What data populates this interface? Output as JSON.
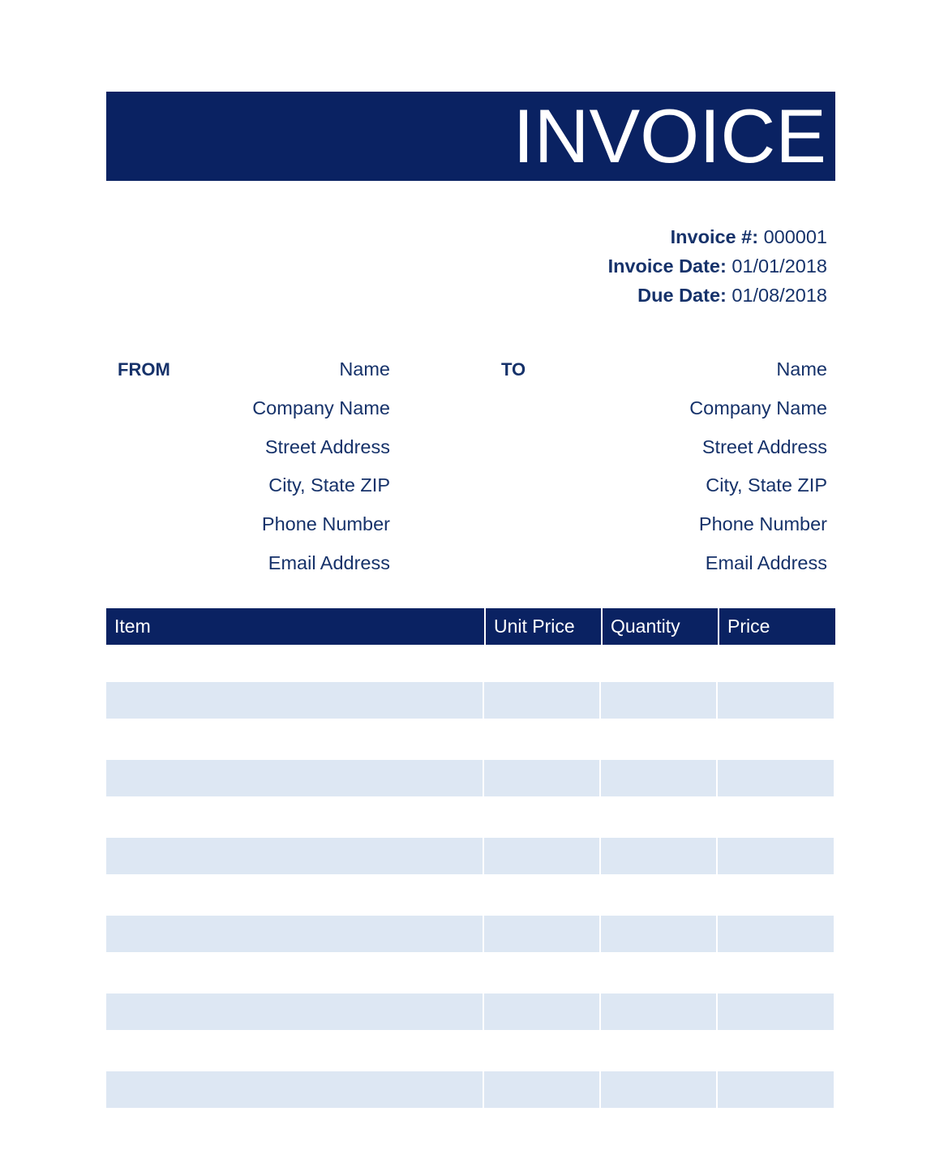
{
  "document": {
    "title": "INVOICE"
  },
  "colors": {
    "navy": "#0a2262",
    "text_navy": "#16326a",
    "row_fill": "#dde7f3",
    "white": "#ffffff"
  },
  "meta": {
    "invoice_number_label": "Invoice #:",
    "invoice_number_value": "000001",
    "invoice_date_label": "Invoice Date:",
    "invoice_date_value": "01/01/2018",
    "due_date_label": "Due Date:",
    "due_date_value": "01/08/2018"
  },
  "from": {
    "label": "FROM",
    "lines": [
      "Name",
      "Company Name",
      "Street Address",
      "City, State ZIP",
      "Phone Number",
      "Email Address"
    ]
  },
  "to": {
    "label": "TO",
    "lines": [
      "Name",
      "Company Name",
      "Street Address",
      "City, State ZIP",
      "Phone Number",
      "Email Address"
    ]
  },
  "items_table": {
    "columns": [
      "Item",
      "Unit Price",
      "Quantity",
      "Price"
    ],
    "rows": [
      {
        "item": "",
        "unit_price": "",
        "quantity": "",
        "price": ""
      },
      {
        "item": "",
        "unit_price": "",
        "quantity": "",
        "price": ""
      },
      {
        "item": "",
        "unit_price": "",
        "quantity": "",
        "price": ""
      },
      {
        "item": "",
        "unit_price": "",
        "quantity": "",
        "price": ""
      },
      {
        "item": "",
        "unit_price": "",
        "quantity": "",
        "price": ""
      },
      {
        "item": "",
        "unit_price": "",
        "quantity": "",
        "price": ""
      }
    ]
  }
}
